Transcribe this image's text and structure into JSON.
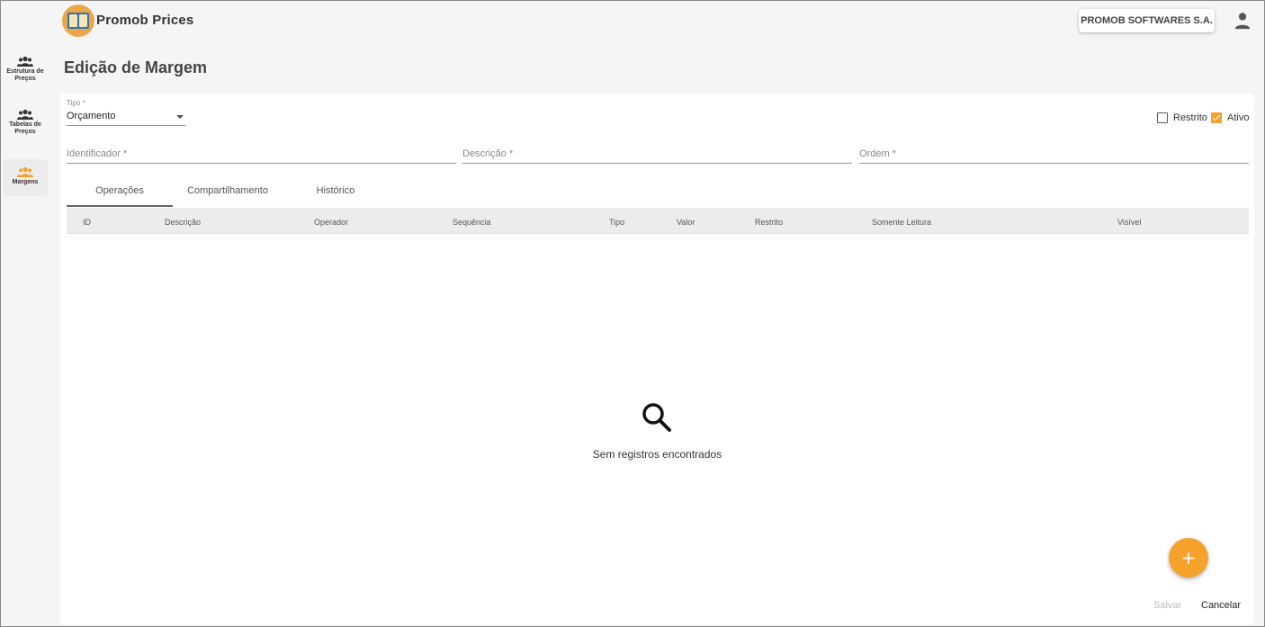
{
  "header": {
    "app_title": "Promob Prices",
    "company": "PROMOB SOFTWARES S.A."
  },
  "sidebar": {
    "items": [
      {
        "label_line1": "Estrutura de",
        "label_line2": "Preços",
        "active": false
      },
      {
        "label_line1": "Tabelas de",
        "label_line2": "Preços",
        "active": false
      },
      {
        "label_line1": "Margens",
        "label_line2": "",
        "active": true
      }
    ]
  },
  "page": {
    "title": "Edição de Margem"
  },
  "form": {
    "tipo_label": "Tipo *",
    "tipo_value": "Orçamento",
    "restrito_label": "Restrito",
    "restrito_checked": false,
    "ativo_label": "Ativo",
    "ativo_checked": true,
    "identificador_placeholder": "Identificador *",
    "descricao_placeholder": "Descrição *",
    "ordem_placeholder": "Ordem *"
  },
  "tabs": [
    {
      "label": "Operações",
      "active": true
    },
    {
      "label": "Compartilhamento",
      "active": false
    },
    {
      "label": "Histórico",
      "active": false
    }
  ],
  "table": {
    "columns": [
      "ID",
      "Descrição",
      "Operador",
      "Sequência",
      "Tipo",
      "Valor",
      "Restrito",
      "Somente Leitura",
      "Visível"
    ],
    "empty_message": "Sem registros encontrados"
  },
  "actions": {
    "fab_label": "+",
    "save_label": "Salvar",
    "cancel_label": "Cancelar"
  },
  "colors": {
    "accent": "#f7a12d"
  }
}
